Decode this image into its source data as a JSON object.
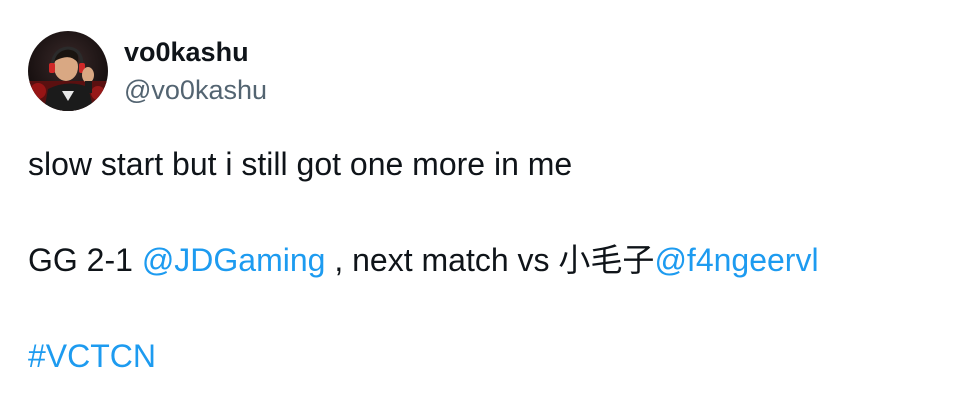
{
  "author": {
    "display_name": "vo0kashu",
    "handle": "@vo0kashu",
    "avatar_icon": "profile-photo"
  },
  "tweet": {
    "line1": "slow start but i still got one more in me",
    "line2": {
      "prefix": "GG 2-1 ",
      "mention1": "@JDGaming",
      "middle": " , next match vs 小毛子",
      "mention2": "@f4ngeervl"
    },
    "hashtag": "#VCTCN"
  },
  "colors": {
    "text": "#0f1419",
    "secondary": "#536471",
    "link": "#1d9bf0"
  }
}
